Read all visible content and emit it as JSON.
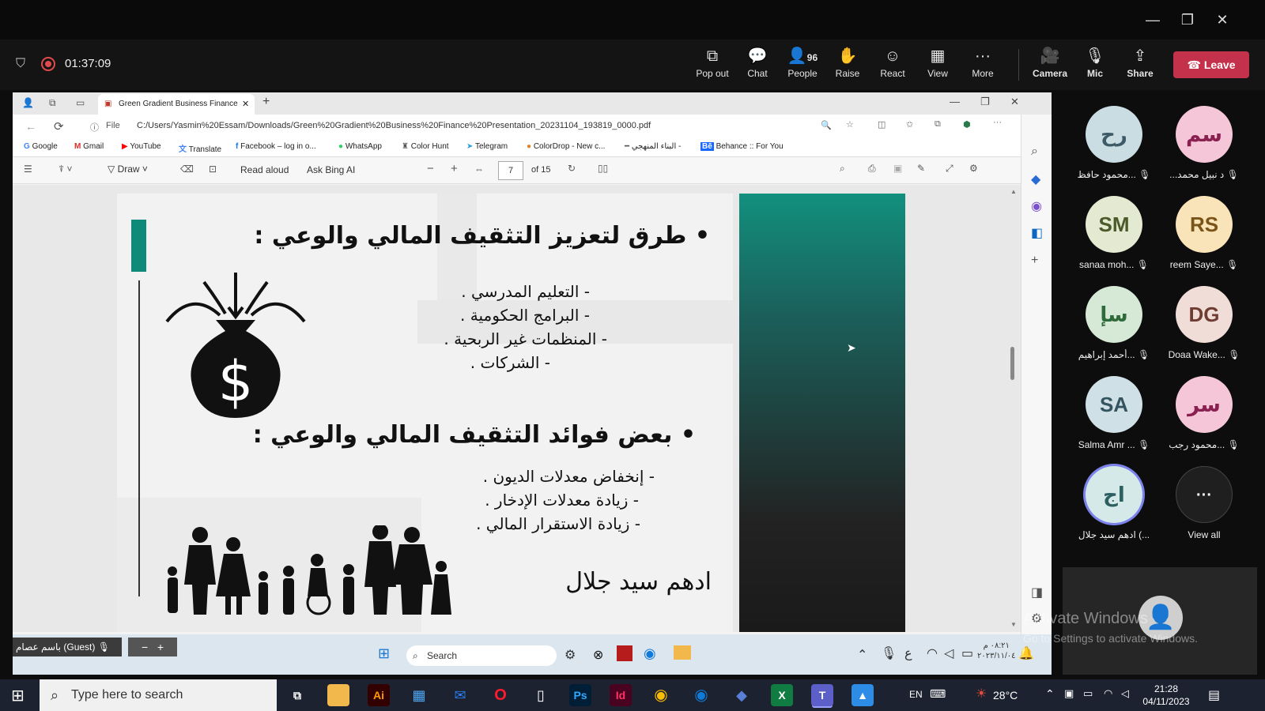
{
  "window": {
    "minimize": "—",
    "restore": "❐",
    "close": "✕"
  },
  "meeting": {
    "recording_time": "01:37:09",
    "tools": [
      {
        "label": "Pop out",
        "icon": "pop-out-icon"
      },
      {
        "label": "Chat",
        "icon": "chat-icon"
      },
      {
        "label": "People",
        "icon": "people-icon",
        "count": "96"
      },
      {
        "label": "Raise",
        "icon": "raise-hand-icon"
      },
      {
        "label": "React",
        "icon": "react-icon"
      },
      {
        "label": "View",
        "icon": "view-icon"
      },
      {
        "label": "More",
        "icon": "more-icon"
      },
      {
        "label": "Camera",
        "icon": "camera-off-icon"
      },
      {
        "label": "Mic",
        "icon": "mic-off-icon"
      },
      {
        "label": "Share",
        "icon": "share-icon"
      }
    ],
    "leave_label": "Leave"
  },
  "browser": {
    "tab_title": "Green Gradient Business Finance",
    "file_label": "File",
    "url": "C:/Users/Yasmin%20Essam/Downloads/Green%20Gradient%20Business%20Finance%20Presentation_20231104_193819_0000.pdf",
    "bookmarks": [
      "Google",
      "Gmail",
      "YouTube",
      "Translate",
      "Facebook – log in o...",
      "WhatsApp",
      "Color Hunt",
      "Telegram",
      "ColorDrop - New c...",
      "البناء المنهجي -",
      "Behance :: For You"
    ]
  },
  "pdf_toolbar": {
    "draw": "Draw",
    "read_aloud": "Read aloud",
    "ask_bing": "Ask Bing AI",
    "page": "7",
    "of_pages": "of 15"
  },
  "slide": {
    "heading1": "• طرق لتعزيز التثقيف المالي والوعي :",
    "list1": [
      "- التعليم المدرسي .",
      "- البرامج الحكومية .",
      "- المنظمات غير الربحية .",
      "- الشركات ."
    ],
    "heading2": "• بعض فوائد التثقيف المالي والوعي :",
    "list2": [
      "- إنخفاض معدلات الديون .",
      "- زيادة معدلات الإدخار .",
      "- زيادة الاستقرار المالي ."
    ],
    "author": "ادهم سيد جلال",
    "accent_color": "#0f8a78"
  },
  "shared_taskbar": {
    "guest_name": "باسم عصام (Guest)",
    "search": "Search",
    "clock_time": "٠٨:٢١ م",
    "clock_date": "٢٠٢٣/١١/٠٤"
  },
  "participants": [
    {
      "initials": "رح",
      "name": "محمود حافظ...",
      "bg": "#c9dde3",
      "fg": "#3d5a66"
    },
    {
      "initials": "سم",
      "name": "...د نبيل محمد",
      "bg": "#f5c6d8",
      "fg": "#8a2050"
    },
    {
      "initials": "SM",
      "name": "sanaa moh...",
      "bg": "#e3ead1",
      "fg": "#4b5a2a"
    },
    {
      "initials": "RS",
      "name": "reem Saye...",
      "bg": "#f8e4b8",
      "fg": "#7a5318"
    },
    {
      "initials": "سإ",
      "name": "أحمد إبراهيم...",
      "bg": "#d5e9d6",
      "fg": "#2f6a3a"
    },
    {
      "initials": "DG",
      "name": "Doaa Wake...",
      "bg": "#f1ddd8",
      "fg": "#6e3c33"
    },
    {
      "initials": "SA",
      "name": "Salma Amr ...",
      "bg": "#cfe0e6",
      "fg": "#34545f"
    },
    {
      "initials": "سر",
      "name": "محمود رجب...",
      "bg": "#f5c6d8",
      "fg": "#8a2050"
    },
    {
      "initials": "اج",
      "name": "ادهم سيد جلال (...",
      "bg": "#d5e9e9",
      "fg": "#2c5f60"
    }
  ],
  "view_all": "View all",
  "watermark": {
    "line1": "Activate Windows",
    "line2": "Go to Settings to activate Windows."
  },
  "windows_taskbar": {
    "search_placeholder": "Type here to search",
    "lang": "EN",
    "weather": "28°C",
    "time": "21:28",
    "date": "04/11/2023"
  }
}
